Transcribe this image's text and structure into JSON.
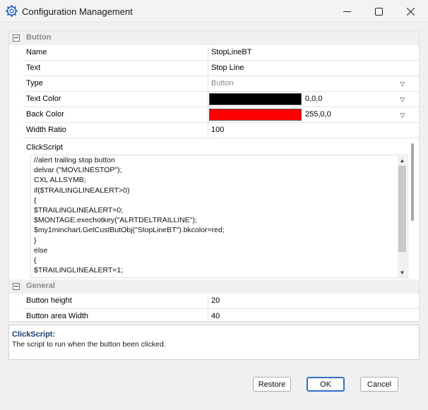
{
  "window": {
    "title": "Configuration Management",
    "icons": {
      "app": "gear-icon",
      "minimize": "minimize-icon",
      "maximize": "maximize-icon",
      "close": "close-icon"
    }
  },
  "categories": {
    "button": "Button",
    "general": "General"
  },
  "button_props": {
    "name": {
      "label": "Name",
      "value": "StopLineBT"
    },
    "text": {
      "label": "Text",
      "value": "Stop Line"
    },
    "type": {
      "label": "Type",
      "value": "Button"
    },
    "text_color": {
      "label": "Text Color",
      "value": "0,0,0",
      "swatch": "#000000"
    },
    "back_color": {
      "label": "Back Color",
      "value": "255,0,0",
      "swatch": "#ff0000"
    },
    "width_ratio": {
      "label": "Width Ratio",
      "value": "100"
    },
    "click_script": {
      "label": "ClickScript",
      "lines": [
        "//alert trailing stop button",
        "delvar (\"MOVLINESTOP\");",
        "CXL ALLSYMB;",
        "if($TRAILINGLINEALERT>0)",
        "{",
        "$TRAILINGLINEALERT=0;",
        "$MONTAGE.exechotkey(\"ALRTDELTRAILLINE\");",
        "$my1minchart.GetCustButObj(\"StopLineBT\").bkcolor=red;",
        "}",
        "else",
        "{",
        "$TRAILINGLINEALERT=1;"
      ]
    }
  },
  "general_props": {
    "button_height": {
      "label": "Button height",
      "value": "20"
    },
    "button_area_width": {
      "label": "Button area Width",
      "value": "40"
    }
  },
  "description": {
    "title": "ClickScript:",
    "text": "The script to run when the button been clicked."
  },
  "buttons": {
    "restore": "Restore",
    "ok": "OK",
    "cancel": "Cancel"
  }
}
